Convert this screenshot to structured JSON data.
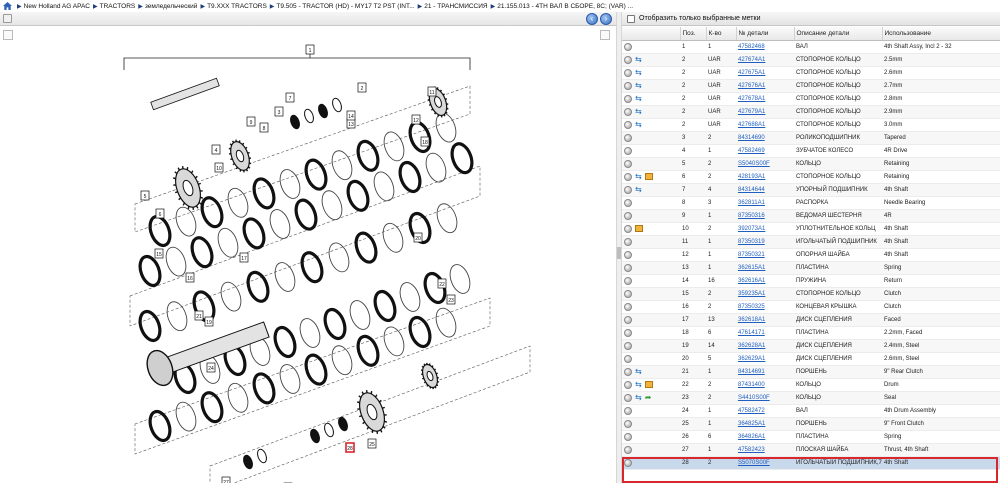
{
  "breadcrumb": [
    "New Holland AG APAC",
    "TRACTORS",
    "земледельческий",
    "T9.XXX TRACTORS",
    "T9.505 - TRACTOR (HD) - MY17 T2 PST (INT...",
    "21 - ТРАНСМИССИЯ",
    "21.155.013 - 4TH ВАЛ В СБОРЕ, 8C; (VAR) ..."
  ],
  "filter": {
    "label": "Отобразить только выбранные метки"
  },
  "table": {
    "columns": [
      "Поз.",
      "К-во",
      "№ детали",
      "Описание детали",
      "Использование"
    ],
    "rows": [
      {
        "pos": "1",
        "qty": "1",
        "part": "47582468",
        "desc": "ВАЛ",
        "use": "4th Shaft Assy, Incl 2 - 32",
        "icons": []
      },
      {
        "pos": "2",
        "qty": "UAR",
        "part": "427674A1",
        "desc": "СТОПОРНОЕ КОЛЬЦО",
        "use": "2.5mm",
        "icons": [
          "swap"
        ]
      },
      {
        "pos": "2",
        "qty": "UAR",
        "part": "427675A1",
        "desc": "СТОПОРНОЕ КОЛЬЦО",
        "use": "2.6mm",
        "icons": [
          "swap"
        ]
      },
      {
        "pos": "2",
        "qty": "UAR",
        "part": "427676A1",
        "desc": "СТОПОРНОЕ КОЛЬЦО",
        "use": "2.7mm",
        "icons": [
          "swap"
        ]
      },
      {
        "pos": "2",
        "qty": "UAR",
        "part": "427678A1",
        "desc": "СТОПОРНОЕ КОЛЬЦО",
        "use": "2.8mm",
        "icons": [
          "swap"
        ]
      },
      {
        "pos": "2",
        "qty": "UAR",
        "part": "427679A1",
        "desc": "СТОПОРНОЕ КОЛЬЦО",
        "use": "2.9mm",
        "icons": [
          "swap"
        ]
      },
      {
        "pos": "2",
        "qty": "UAR",
        "part": "427688A1",
        "desc": "СТОПОРНОЕ КОЛЬЦО",
        "use": "3.0mm",
        "icons": [
          "swap"
        ]
      },
      {
        "pos": "3",
        "qty": "2",
        "part": "84314690",
        "desc": "РОЛИКОПОДШИПНИК",
        "use": "Tapered",
        "icons": []
      },
      {
        "pos": "4",
        "qty": "1",
        "part": "47582469",
        "desc": "ЗУБЧАТОЕ КОЛЕСО",
        "use": "4R Drive",
        "icons": []
      },
      {
        "pos": "5",
        "qty": "2",
        "part": "S5040S00F",
        "desc": "КОЛЬЦО",
        "use": "Retaining",
        "icons": []
      },
      {
        "pos": "6",
        "qty": "2",
        "part": "428193A1",
        "desc": "СТОПОРНОЕ КОЛЬЦО",
        "use": "Retaining",
        "icons": [
          "swap",
          "box"
        ]
      },
      {
        "pos": "7",
        "qty": "4",
        "part": "84314644",
        "desc": "УПОРНЫЙ ПОДШИПНИК",
        "use": "4th Shaft",
        "icons": [
          "swap"
        ]
      },
      {
        "pos": "8",
        "qty": "3",
        "part": "362811A1",
        "desc": "РАСПОРКА",
        "use": "Needle Bearing",
        "icons": []
      },
      {
        "pos": "9",
        "qty": "1",
        "part": "87350316",
        "desc": "ВЕДОМАЯ ШЕСТЕРНЯ",
        "use": "4R",
        "icons": []
      },
      {
        "pos": "10",
        "qty": "2",
        "part": "392073A1",
        "desc": "УПЛОТНИТЕЛЬНОЕ КОЛЬЦ",
        "use": "4th Shaft",
        "icons": [
          "box"
        ]
      },
      {
        "pos": "11",
        "qty": "1",
        "part": "87350319",
        "desc": "ИГОЛЬЧАТЫЙ ПОДШИПНИК",
        "use": "4th Shaft",
        "icons": []
      },
      {
        "pos": "12",
        "qty": "1",
        "part": "87350321",
        "desc": "ОПОРНАЯ ШАЙБА",
        "use": "4th Shaft",
        "icons": []
      },
      {
        "pos": "13",
        "qty": "1",
        "part": "362615A1",
        "desc": "ПЛАСТИНА",
        "use": "Spring",
        "icons": []
      },
      {
        "pos": "14",
        "qty": "16",
        "part": "362616A1",
        "desc": "ПРУЖИНА",
        "use": "Return",
        "icons": []
      },
      {
        "pos": "15",
        "qty": "2",
        "part": "359235A1",
        "desc": "СТОПОРНОЕ КОЛЬЦО",
        "use": "Clutch",
        "icons": []
      },
      {
        "pos": "16",
        "qty": "2",
        "part": "87350325",
        "desc": "КОНЦЕВАЯ КРЫШКА",
        "use": "Clutch",
        "icons": []
      },
      {
        "pos": "17",
        "qty": "13",
        "part": "362618A1",
        "desc": "ДИСК СЦЕПЛЕНИЯ",
        "use": "Faced",
        "icons": []
      },
      {
        "pos": "18",
        "qty": "6",
        "part": "47614171",
        "desc": "ПЛАСТИНА",
        "use": "2.2mm, Faced",
        "icons": []
      },
      {
        "pos": "19",
        "qty": "14",
        "part": "362628A1",
        "desc": "ДИСК СЦЕПЛЕНИЯ",
        "use": "2.4mm, Steel",
        "icons": []
      },
      {
        "pos": "20",
        "qty": "5",
        "part": "362629A1",
        "desc": "ДИСК СЦЕПЛЕНИЯ",
        "use": "2.6mm, Steel",
        "icons": []
      },
      {
        "pos": "21",
        "qty": "1",
        "part": "84314691",
        "desc": "ПОРШЕНЬ",
        "use": "9\" Rear Clutch",
        "icons": [
          "swap"
        ]
      },
      {
        "pos": "22",
        "qty": "2",
        "part": "87431400",
        "desc": "КОЛЬЦО",
        "use": "Drum",
        "icons": [
          "swap",
          "box"
        ]
      },
      {
        "pos": "23",
        "qty": "2",
        "part": "S4410S00F",
        "desc": "КОЛЬЦО",
        "use": "Seal",
        "icons": [
          "swap",
          "arrow"
        ]
      },
      {
        "pos": "24",
        "qty": "1",
        "part": "47582472",
        "desc": "ВАЛ",
        "use": "4th Drum Assembly",
        "icons": []
      },
      {
        "pos": "25",
        "qty": "1",
        "part": "364825A1",
        "desc": "ПОРШЕНЬ",
        "use": "9\" Front Clutch",
        "icons": []
      },
      {
        "pos": "26",
        "qty": "6",
        "part": "364826A1",
        "desc": "ПЛАСТИНА",
        "use": "Spring",
        "icons": []
      },
      {
        "pos": "27",
        "qty": "1",
        "part": "47582423",
        "desc": "ПЛОСКАЯ ШАЙБА",
        "use": "Thrust, 4th Shaft",
        "icons": []
      },
      {
        "pos": "28",
        "qty": "2",
        "part": "S5070S00F",
        "desc": "ИГОЛЬЧАТЫЙ ПОДШИПНИК,76.2mm ID x",
        "use": "4th Shaft",
        "icons": [],
        "selected": true
      }
    ]
  },
  "diagram": {
    "callouts": [
      "1",
      "2",
      "3",
      "4",
      "5",
      "6",
      "7",
      "8",
      "9",
      "10",
      "11",
      "12",
      "13",
      "14",
      "15",
      "16",
      "17",
      "18",
      "19",
      "20",
      "21",
      "22",
      "23",
      "24",
      "25",
      "26",
      "27",
      "28"
    ],
    "highlighted_callout": "28"
  },
  "colors": {
    "link": "#1f5fbf",
    "selection_frame": "#d9272e",
    "selection_row": "#c9d9ec",
    "callout_highlight": "#d9272e"
  }
}
